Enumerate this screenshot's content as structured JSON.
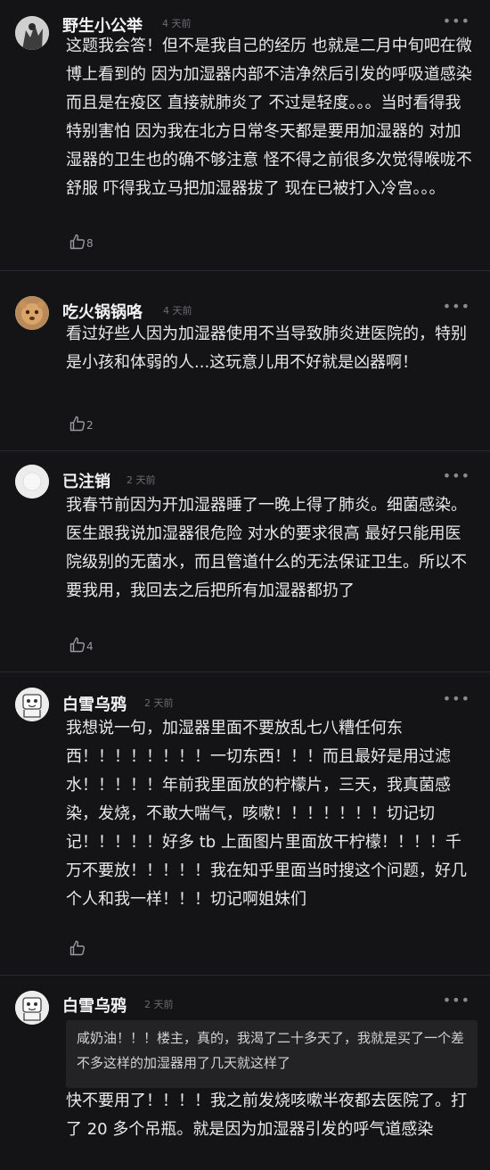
{
  "comments": [
    {
      "username": "野生小公举",
      "time": "4 天前",
      "more": "•••",
      "content": "这题我会答！但不是我自己的经历 也就是二月中旬吧在微博上看到的 因为加湿器内部不洁净然后引发的呼吸道感染 而且是在疫区 直接就肺炎了 不过是轻度。。。当时看得我特别害怕 因为我在北方日常冬天都是要用加湿器的 对加湿器的卫生也的确不够注意 怪不得之前很多次觉得喉咙不舒服 吓得我立马把加湿器拔了 现在已被打入冷宫。。。",
      "likes": "8"
    },
    {
      "username": "吃火锅锅咯",
      "time": "4 天前",
      "more": "•••",
      "content": "看过好些人因为加湿器使用不当导致肺炎进医院的，特别是小孩和体弱的人...这玩意儿用不好就是凶器啊！",
      "likes": "2"
    },
    {
      "username": "已注销",
      "time": "2 天前",
      "more": "•••",
      "content": "我春节前因为开加湿器睡了一晚上得了肺炎。细菌感染。医生跟我说加湿器很危险 对水的要求很高 最好只能用医院级别的无菌水，而且管道什么的无法保证卫生。所以不要我用，我回去之后把所有加湿器都扔了",
      "likes": "4"
    },
    {
      "username": "白雪乌鸦",
      "time": "2 天前",
      "more": "•••",
      "content": "我想说一句，加湿器里面不要放乱七八糟任何东西！！！！！！！！一切东西！！！而且最好是用过滤水！！！！！年前我里面放的柠檬片，三天，我真菌感染，发烧，不敢大喘气，咳嗽！！！！！！！切记切记！！！！！好多 tb 上面图片里面放干柠檬！！！！千万不要放！！！！！我在知乎里面当时搜这个问题，好几个人和我一样！！！切记啊姐妹们",
      "likes": ""
    },
    {
      "username": "白雪乌鸦",
      "time": "2 天前",
      "more": "•••",
      "quote": "咸奶油！！！楼主，真的，我渴了二十多天了，我就是买了一个差不多这样的加湿器用了几天就这样了",
      "content": "快不要用了！！！！我之前发烧咳嗽半夜都去医院了。打了 20 多个吊瓶。就是因为加湿器引发的呼气道感染",
      "likes": ""
    }
  ],
  "colors": {
    "background": "#141416",
    "text": "#e9e9e9",
    "muted": "#6c6c70",
    "quote_bg": "#232326"
  },
  "icons": {
    "like": "thumbs-up-icon",
    "more": "more-options-icon"
  }
}
